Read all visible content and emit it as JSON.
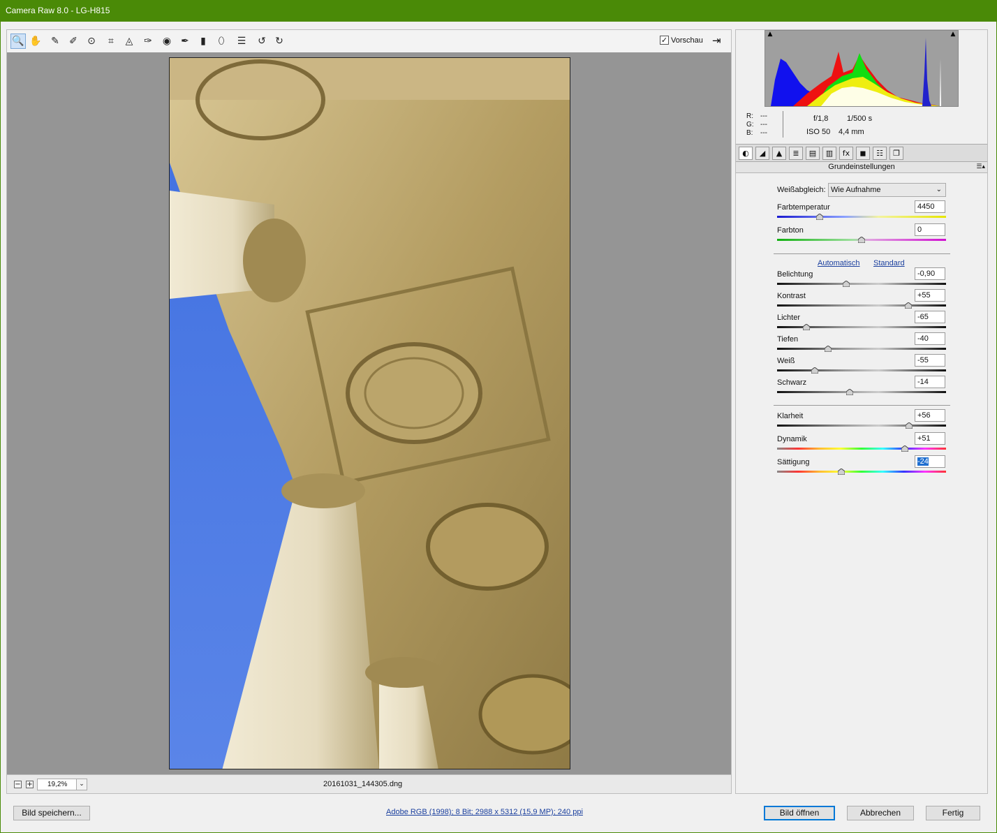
{
  "window": {
    "title": "Camera Raw 8.0 - LG-H815"
  },
  "toolbar": {
    "tools": [
      {
        "name": "zoom-tool",
        "glyph": "🔍"
      },
      {
        "name": "hand-tool",
        "glyph": "✋"
      },
      {
        "name": "white-balance-tool",
        "glyph": "✎"
      },
      {
        "name": "color-sampler-tool",
        "glyph": "✐"
      },
      {
        "name": "target-adjustment-tool",
        "glyph": "⊙"
      },
      {
        "name": "crop-tool",
        "glyph": "⌗"
      },
      {
        "name": "straighten-tool",
        "glyph": "◬"
      },
      {
        "name": "spot-removal-tool",
        "glyph": "✑"
      },
      {
        "name": "red-eye-tool",
        "glyph": "◉"
      },
      {
        "name": "adjustment-brush-tool",
        "glyph": "✒"
      },
      {
        "name": "graduated-filter-tool",
        "glyph": "▮"
      },
      {
        "name": "radial-filter-tool",
        "glyph": "⬯"
      },
      {
        "name": "preferences-tool",
        "glyph": "☰"
      },
      {
        "name": "rotate-ccw-tool",
        "glyph": "↺"
      },
      {
        "name": "rotate-cw-tool",
        "glyph": "↻"
      }
    ],
    "preview_label": "Vorschau",
    "preview_check": "✓",
    "fullscreen_glyph": "⇥"
  },
  "status": {
    "zoom_minus": "−",
    "zoom_plus": "+",
    "zoom_value": "19,2%",
    "zoom_drop": "⌄",
    "filename": "20161031_144305.dng"
  },
  "histogram": {
    "shadow_clip": "▲",
    "highlight_clip": "▲",
    "r_label": "R:",
    "g_label": "G:",
    "b_label": "B:",
    "r_value": "---",
    "g_value": "---",
    "b_value": "---",
    "aperture": "f/1,8",
    "shutter": "1/500 s",
    "iso": "ISO 50",
    "focal": "4,4 mm"
  },
  "panel_tabs": [
    {
      "name": "basic-tab",
      "glyph": "◐"
    },
    {
      "name": "tone-curve-tab",
      "glyph": "◢"
    },
    {
      "name": "detail-tab",
      "glyph": "▲"
    },
    {
      "name": "hsl-tab",
      "glyph": "≣"
    },
    {
      "name": "split-toning-tab",
      "glyph": "▤"
    },
    {
      "name": "lens-corrections-tab",
      "glyph": "▥"
    },
    {
      "name": "effects-tab",
      "glyph": "fx"
    },
    {
      "name": "camera-calibration-tab",
      "glyph": "◼"
    },
    {
      "name": "presets-tab",
      "glyph": "☷"
    },
    {
      "name": "snapshots-tab",
      "glyph": "❐"
    }
  ],
  "panel": {
    "title": "Grundeinstellungen",
    "menu_glyph": "☰▴",
    "wb_label": "Weißabgleich:",
    "wb_value": "Wie Aufnahme",
    "wb_arrow": "⌄",
    "auto_link": "Automatisch",
    "default_link": "Standard"
  },
  "sliders": [
    {
      "key": "temp",
      "label": "Farbtemperatur",
      "value": "4450",
      "pos": 0.25,
      "track": "temp"
    },
    {
      "key": "tint",
      "label": "Farbton",
      "value": "0",
      "pos": 0.5,
      "track": "tint"
    },
    {
      "key": "exposure",
      "label": "Belichtung",
      "value": "-0,90",
      "pos": 0.41,
      "track": "gray"
    },
    {
      "key": "contrast",
      "label": "Kontrast",
      "value": "+55",
      "pos": 0.775,
      "track": "gray"
    },
    {
      "key": "highlights",
      "label": "Lichter",
      "value": "-65",
      "pos": 0.175,
      "track": "gray"
    },
    {
      "key": "shadows",
      "label": "Tiefen",
      "value": "-40",
      "pos": 0.3,
      "track": "gray"
    },
    {
      "key": "whites",
      "label": "Weiß",
      "value": "-55",
      "pos": 0.225,
      "track": "gray"
    },
    {
      "key": "blacks",
      "label": "Schwarz",
      "value": "-14",
      "pos": 0.43,
      "track": "gray"
    },
    {
      "key": "clarity",
      "label": "Klarheit",
      "value": "+56",
      "pos": 0.78,
      "track": "gray"
    },
    {
      "key": "vibrance",
      "label": "Dynamik",
      "value": "+51",
      "pos": 0.755,
      "track": "rainbow"
    },
    {
      "key": "saturation",
      "label": "Sättigung",
      "value": "-24",
      "pos": 0.38,
      "track": "rainbow",
      "selected": true
    }
  ],
  "footer": {
    "save_label": "Bild speichern...",
    "info_link": "Adobe RGB (1998); 8 Bit; 2988 x 5312 (15,9 MP); 240 ppi",
    "open_label": "Bild öffnen",
    "cancel_label": "Abbrechen",
    "done_label": "Fertig"
  },
  "colors": {
    "titlebar": "#4a8a07",
    "canvas": "#959595",
    "link": "#1a3f9e",
    "selection": "#1f6fd0"
  }
}
